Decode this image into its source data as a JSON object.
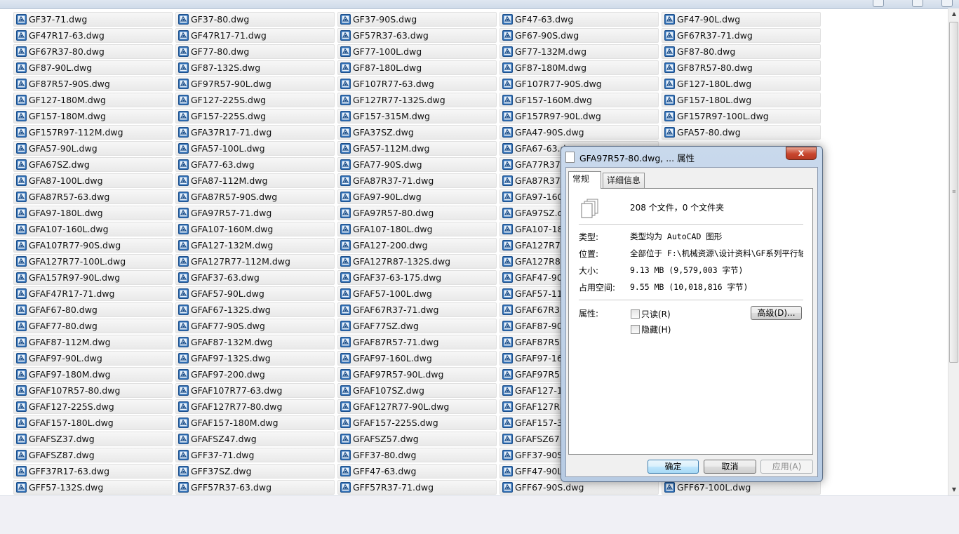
{
  "files": [
    "GF37-71.dwg",
    "GF37-80.dwg",
    "GF37-90S.dwg",
    "GF47-63.dwg",
    "GF47-90L.dwg",
    "GF47R17-63.dwg",
    "GF47R17-71.dwg",
    "GF57R37-63.dwg",
    "GF67-90S.dwg",
    "GF67R37-71.dwg",
    "GF67R37-80.dwg",
    "GF77-80.dwg",
    "GF77-100L.dwg",
    "GF77-132M.dwg",
    "GF87-80.dwg",
    "GF87-90L.dwg",
    "GF87-132S.dwg",
    "GF87-180L.dwg",
    "GF87-180M.dwg",
    "GF87R57-80.dwg",
    "GF87R57-90S.dwg",
    "GF97R57-90L.dwg",
    "GF107R77-63.dwg",
    "GF107R77-90S.dwg",
    "GF127-180L.dwg",
    "GF127-180M.dwg",
    "GF127-225S.dwg",
    "GF127R77-132S.dwg",
    "GF157-160M.dwg",
    "GF157-180L.dwg",
    "GF157-180M.dwg",
    "GF157-225S.dwg",
    "GF157-315M.dwg",
    "GF157R97-90L.dwg",
    "GF157R97-100L.dwg",
    "GF157R97-112M.dwg",
    "GFA37R17-71.dwg",
    "GFA37SZ.dwg",
    "GFA47-90S.dwg",
    "GFA57-80.dwg",
    "GFA57-90L.dwg",
    "GFA57-100L.dwg",
    "GFA57-112M.dwg",
    "GFA67-63.dwg",
    "",
    "GFA67SZ.dwg",
    "GFA77-63.dwg",
    "GFA77-90S.dwg",
    "GFA77R37-71.dwg",
    "",
    "GFA87-100L.dwg",
    "GFA87-112M.dwg",
    "GFA87R37-71.dwg",
    "GFA87R37-80.dwg",
    "",
    "GFA87R57-63.dwg",
    "GFA87R57-90S.dwg",
    "GFA97-90L.dwg",
    "GFA97-160M.dwg",
    "",
    "GFA97-180L.dwg",
    "GFA97R57-71.dwg",
    "GFA97R57-80.dwg",
    "GFA97SZ.dwg",
    "",
    "GFA107-160L.dwg",
    "GFA107-160M.dwg",
    "GFA107-180L.dwg",
    "GFA107-180M.dwg",
    "",
    "GFA107R77-90S.dwg",
    "GFA127-132M.dwg",
    "GFA127-200.dwg",
    "GFA127R77-63.dwg",
    "",
    "GFA127R77-100L.dwg",
    "GFA127R77-112M.dwg",
    "GFA127R87-132S.dwg",
    "GFA127R87-100L.dwg",
    "",
    "GFA157R97-90L.dwg",
    "GFAF37-63.dwg",
    "GFAF37-63-175.dwg",
    "GFAF47-90L.dwg",
    "",
    "GFAF47R17-71.dwg",
    "GFAF57-90L.dwg",
    "GFAF57-100L.dwg",
    "GFAF57-112M.dwg",
    "",
    "GFAF67-80.dwg",
    "GFAF67-132S.dwg",
    "GFAF67R37-71.dwg",
    "GFAF67R37-80.dwg",
    "",
    "GFAF77-80.dwg",
    "GFAF77-90S.dwg",
    "GFAF77SZ.dwg",
    "GFAF87-90L.dwg",
    "",
    "GFAF87-112M.dwg",
    "GFAF87-132M.dwg",
    "GFAF87R57-71.dwg",
    "GFAF87R57-80.dwg",
    "",
    "GFAF97-90L.dwg",
    "GFAF97-132S.dwg",
    "GFAF97-160L.dwg",
    "GFAF97-160M.dwg",
    "",
    "GFAF97-180M.dwg",
    "GFAF97-200.dwg",
    "GFAF97R57-90L.dwg",
    "GFAF97R57-71.dwg",
    "",
    "GFAF107R57-80.dwg",
    "GFAF107R77-63.dwg",
    "GFAF107SZ.dwg",
    "GFAF127-132M.dwg",
    "",
    "GFAF127-225S.dwg",
    "GFAF127R77-80.dwg",
    "GFAF127R77-90L.dwg",
    "GFAF127R87-80.dwg",
    "",
    "GFAF157-180L.dwg",
    "GFAF157-180M.dwg",
    "GFAF157-225S.dwg",
    "GFAF157-315M.dwg",
    "",
    "GFAFSZ37.dwg",
    "GFAFSZ47.dwg",
    "GFAFSZ57.dwg",
    "GFAFSZ67.dwg",
    "",
    "GFAFSZ87.dwg",
    "GFF37-71.dwg",
    "GFF37-80.dwg",
    "GFF37-90S.dwg",
    "",
    "GFF37R17-63.dwg",
    "GFF37SZ.dwg",
    "GFF47-63.dwg",
    "GFF47-90L.dwg",
    "",
    "GFF57-132S.dwg",
    "GFF57R37-63.dwg",
    "GFF57R37-71.dwg",
    "GFF67-90S.dwg",
    "GFF67-100L.dwg"
  ],
  "dialog": {
    "title": "GFA97R57-80.dwg, ... 属性",
    "close_label": "x",
    "tabs": [
      "常规",
      "详细信息"
    ],
    "summary": "208 个文件，0 个文件夹",
    "type_label": "类型:",
    "type_value": "类型均为 AutoCAD 图形",
    "location_label": "位置:",
    "location_value": "全部位于 F:\\机械资源\\设计资料\\GF系列平行轴",
    "size_label": "大小:",
    "size_value": "9.13 MB (9,579,003 字节)",
    "disk_label": "占用空间:",
    "disk_value": "9.55 MB (10,018,816 字节)",
    "attr_label": "属性:",
    "readonly_label": "只读(R)",
    "hidden_label": "隐藏(H)",
    "advanced_label": "高级(D)...",
    "ok_label": "确定",
    "cancel_label": "取消",
    "apply_label": "应用(A)"
  },
  "colors": {
    "accent": "#3c7fb1",
    "close": "#c8462e"
  }
}
